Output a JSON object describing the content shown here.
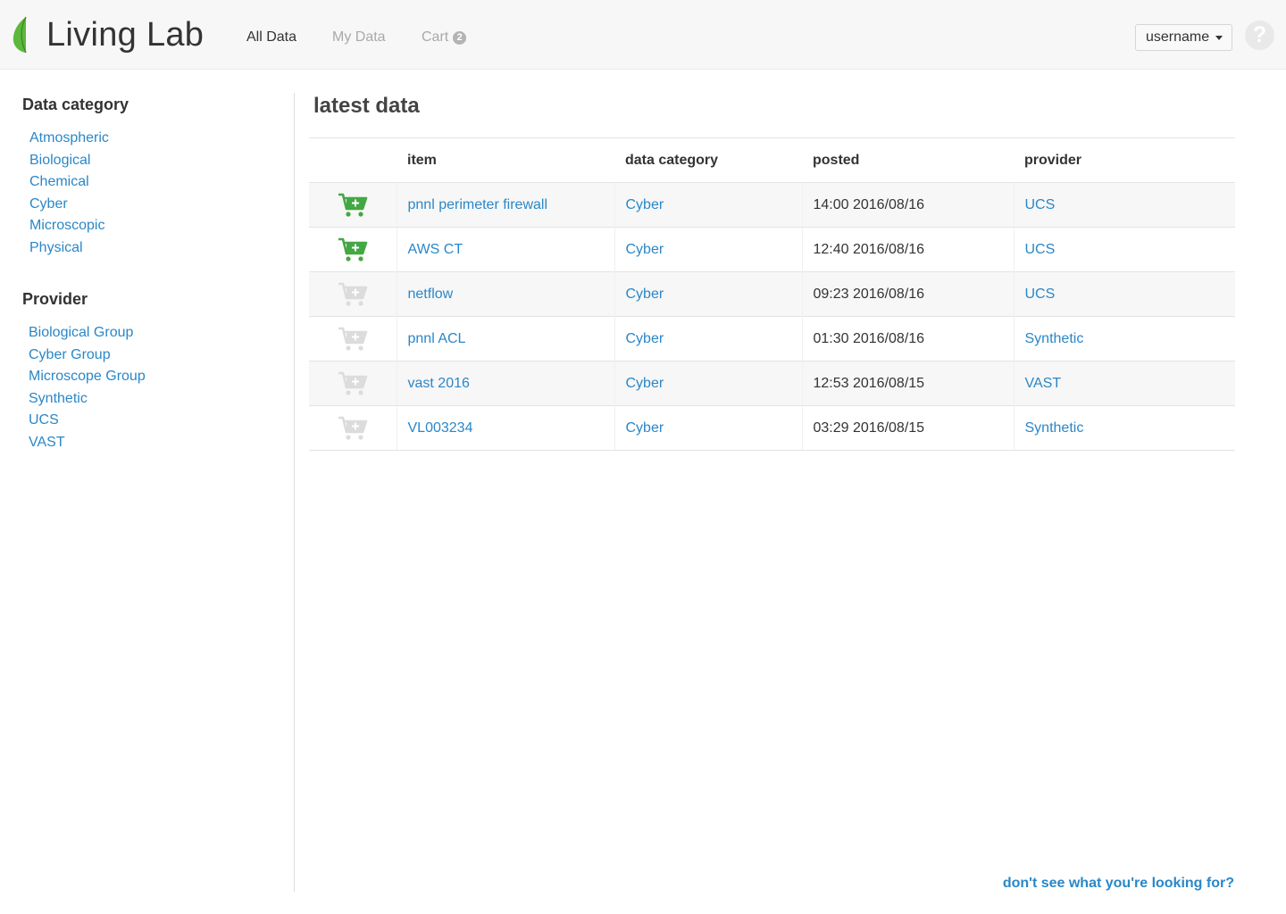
{
  "header": {
    "brand": "Living Lab",
    "nav": {
      "all_data": "All Data",
      "my_data": "My Data",
      "cart": "Cart",
      "cart_count": "2"
    },
    "user_menu": "username",
    "help": "?"
  },
  "sidebar": {
    "category_heading": "Data category",
    "categories": [
      "Atmospheric",
      "Biological",
      "Chemical",
      "Cyber",
      "Microscopic",
      "Physical"
    ],
    "provider_heading": "Provider",
    "providers": [
      "Biological Group",
      "Cyber Group",
      "Microscope Group",
      "Synthetic",
      "UCS",
      "VAST"
    ]
  },
  "main": {
    "title": "latest data",
    "columns": {
      "item": "item",
      "category": "data category",
      "posted": "posted",
      "provider": "provider"
    },
    "rows": [
      {
        "item": "pnnl perimeter firewall",
        "category": "Cyber",
        "posted": "14:00 2016/08/16",
        "provider": "UCS",
        "cart_icon": "cart-plus-icon-active"
      },
      {
        "item": "AWS CT",
        "category": "Cyber",
        "posted": "12:40 2016/08/16",
        "provider": "UCS",
        "cart_icon": "cart-plus-icon-active"
      },
      {
        "item": "netflow",
        "category": "Cyber",
        "posted": "09:23 2016/08/16",
        "provider": "UCS",
        "cart_icon": "cart-plus-icon-disabled"
      },
      {
        "item": "pnnl ACL",
        "category": "Cyber",
        "posted": "01:30 2016/08/16",
        "provider": "Synthetic",
        "cart_icon": "cart-plus-icon-disabled"
      },
      {
        "item": "vast 2016",
        "category": "Cyber",
        "posted": "12:53 2016/08/15",
        "provider": "VAST",
        "cart_icon": "cart-plus-icon-disabled"
      },
      {
        "item": "VL003234",
        "category": "Cyber",
        "posted": "03:29 2016/08/15",
        "provider": "Synthetic",
        "cart_icon": "cart-plus-icon-disabled"
      }
    ],
    "footer_link": "don't see what you're looking for?"
  },
  "colors": {
    "link": "#2a87c8",
    "cart_active": "#43a843",
    "cart_disabled": "#dcdcdc",
    "brand_leaf": "#5cb83c"
  }
}
